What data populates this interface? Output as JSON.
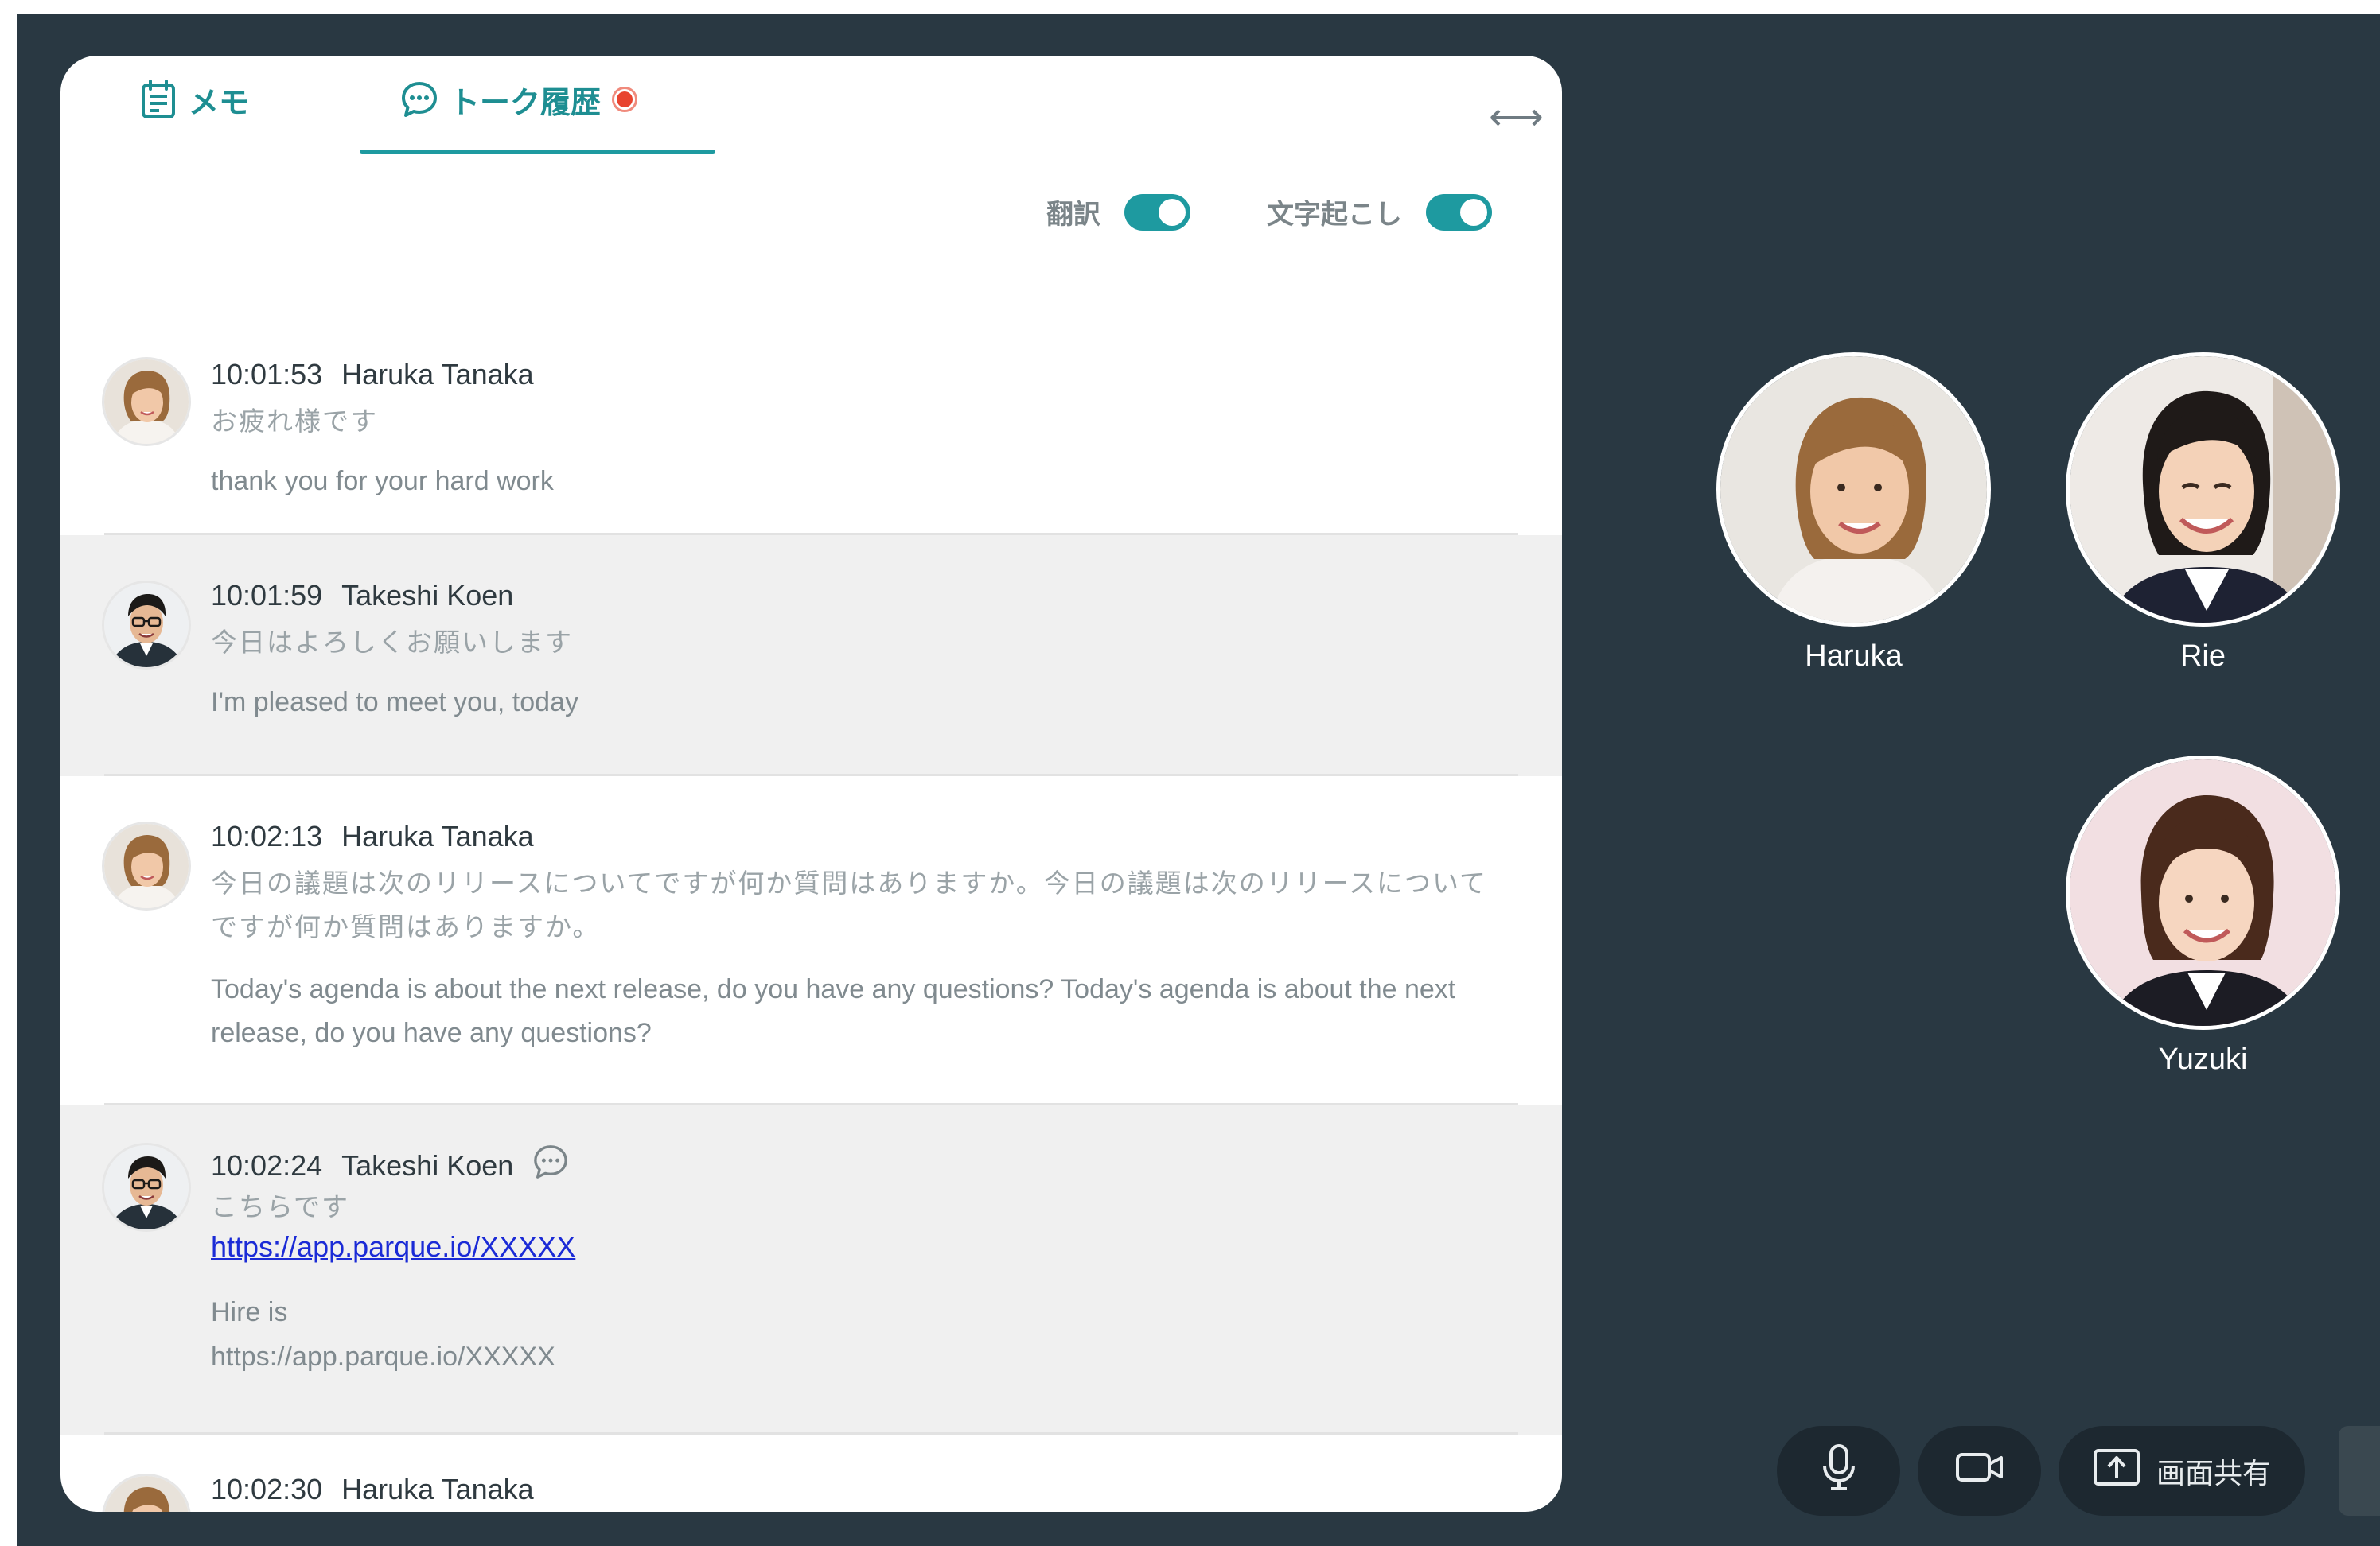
{
  "tabs": {
    "memo": "メモ",
    "history": "トーク履歴"
  },
  "toggles": {
    "translate_label": "翻訳",
    "translate_on": true,
    "transcribe_label": "文字起こし",
    "transcribe_on": true
  },
  "messages": [
    {
      "time": "10:01:53",
      "speaker": "Haruka Tanaka",
      "text": "お疲れ様です",
      "translation": "thank you for your hard work"
    },
    {
      "time": "10:01:59",
      "speaker": "Takeshi Koen",
      "text": "今日はよろしくお願いします",
      "translation": "I'm pleased to meet you, today"
    },
    {
      "time": "10:02:13",
      "speaker": "Haruka Tanaka",
      "text": "今日の議題は次のリリースについてですが何か質問はありますか。今日の議題は次のリリースについてですが何か質問はありますか。",
      "translation": "Today's agenda is about the next release, do you have any questions? Today's agenda is about the next release, do you have any questions?"
    },
    {
      "time": "10:02:24",
      "speaker": "Takeshi Koen",
      "text": "こちらです",
      "link": "https://app.parque.io/XXXXX",
      "translation": "Hire is",
      "translation_link": "https://app.parque.io/XXXXX"
    },
    {
      "time": "10:02:30",
      "speaker": "Haruka Tanaka"
    }
  ],
  "participants": [
    {
      "name": "Haruka"
    },
    {
      "name": "Rie"
    },
    {
      "name": "Yuzuki"
    }
  ],
  "controls": {
    "share_label": "画面共有"
  },
  "colors": {
    "accent": "#1e9aa0",
    "background": "#293842",
    "record": "#e8432f",
    "link": "#1b2bd6"
  }
}
